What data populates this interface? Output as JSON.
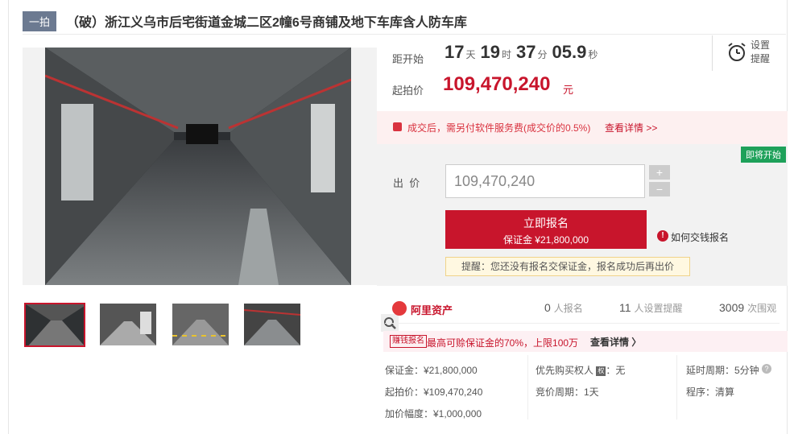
{
  "header": {
    "badge": "一拍",
    "title": "（破）浙江义乌市后宅街道金城二区2幢6号商铺及地下车库含人防车库"
  },
  "countdown": {
    "label": "距开始",
    "days": "17",
    "days_unit": "天",
    "hours": "19",
    "hours_unit": "时",
    "minutes": "37",
    "minutes_unit": "分",
    "seconds": "05.9",
    "seconds_unit": "秒"
  },
  "reminder_setting": {
    "line1": "设置",
    "line2": "提醒"
  },
  "start_price": {
    "label": "起拍价",
    "value": "109,470,240",
    "unit": "元"
  },
  "service_notice": {
    "text": "成交后，需另付软件服务费(成交价的0.5%)",
    "link": "查看详情 >>"
  },
  "bid": {
    "status_tag": "即将开始",
    "label": "出  价",
    "input_value": "109,470,240",
    "plus": "+",
    "minus": "−",
    "signup_line1": "立即报名",
    "signup_line2": "保证金 ¥21,800,000",
    "how_to": "如何交钱报名",
    "tip": "提醒：您还没有报名交保证金，报名成功后再出价"
  },
  "platform": {
    "name": "阿里资产"
  },
  "stats": [
    {
      "num": "0",
      "label": "人报名"
    },
    {
      "num": "11",
      "label": "人设置提醒"
    },
    {
      "num": "3009",
      "label": "次围观"
    }
  ],
  "promo": {
    "tag": "赚钱报名",
    "text": "最高可赊保证金的70%，上限100万",
    "link": "查看详情 〉"
  },
  "details": {
    "deposit": "保证金：¥21,800,000",
    "start_price": "起拍价：¥109,470,240",
    "increment": "加价幅度：¥1,000,000",
    "priority_label": "优先购买权人",
    "priority_icon": "权",
    "priority_value": "：无",
    "bid_cycle": "竞价周期：1天",
    "delay": "延时周期：5分钟",
    "procedure": "程序：清算"
  },
  "colors": {
    "accent": "#c8152c",
    "green": "#1ea15a",
    "badge": "#6c7a91"
  },
  "icons": [
    "alarm-clock-icon",
    "zoom-icon",
    "gift-icon",
    "info-icon",
    "help-icon",
    "alibaba-asset-logo"
  ]
}
